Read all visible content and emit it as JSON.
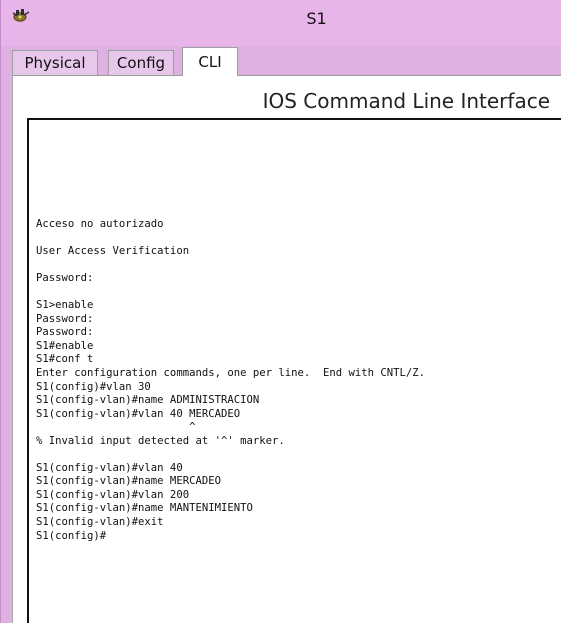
{
  "window": {
    "title": "S1",
    "icon": "packet-tracer-switch-icon"
  },
  "tabs": [
    {
      "label": "Physical",
      "active": false
    },
    {
      "label": "Config",
      "active": false
    },
    {
      "label": "CLI",
      "active": true
    }
  ],
  "cli": {
    "heading": "IOS Command Line Interface",
    "lines": [
      "Acceso no autorizado",
      "",
      "User Access Verification",
      "",
      "Password:",
      "",
      "S1>enable",
      "Password:",
      "Password:",
      "S1#enable",
      "S1#conf t",
      "Enter configuration commands, one per line.  End with CNTL/Z.",
      "S1(config)#vlan 30",
      "S1(config-vlan)#name ADMINISTRACION",
      "S1(config-vlan)#vlan 40 MERCADEO",
      "                        ^",
      "% Invalid input detected at '^' marker.",
      "",
      "S1(config-vlan)#vlan 40",
      "S1(config-vlan)#name MERCADEO",
      "S1(config-vlan)#vlan 200",
      "S1(config-vlan)#name MANTENIMIENTO",
      "S1(config-vlan)#exit",
      "S1(config)#"
    ]
  }
}
